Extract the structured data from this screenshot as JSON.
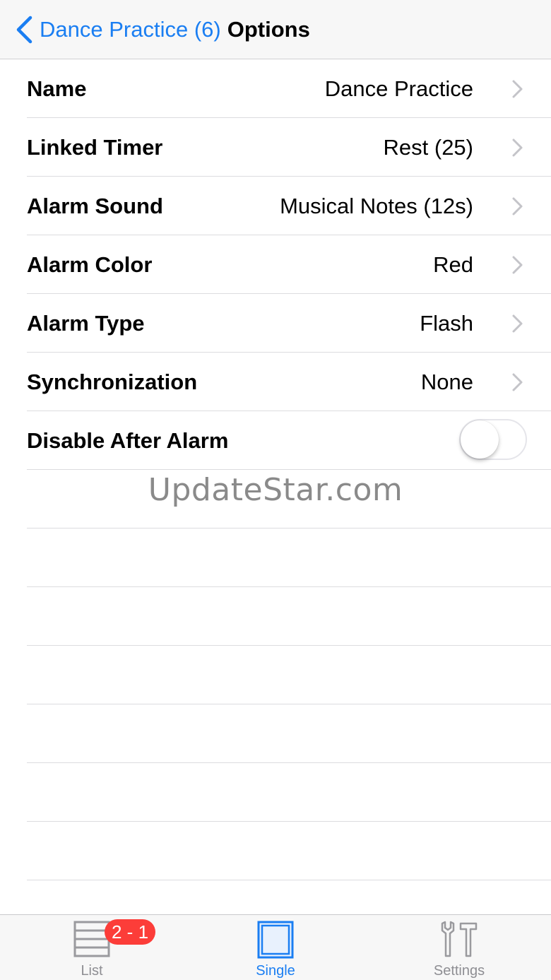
{
  "navbar": {
    "back_label": "Dance Practice (6)",
    "title": "Options"
  },
  "rows": [
    {
      "label": "Name",
      "value": "Dance Practice"
    },
    {
      "label": "Linked Timer",
      "value": "Rest (25)"
    },
    {
      "label": "Alarm Sound",
      "value": "Musical Notes (12s)"
    },
    {
      "label": "Alarm Color",
      "value": "Red"
    },
    {
      "label": "Alarm Type",
      "value": "Flash"
    },
    {
      "label": "Synchronization",
      "value": "None"
    }
  ],
  "toggle_row": {
    "label": "Disable After Alarm",
    "on": false
  },
  "watermark": "UpdateStar.com",
  "tabbar": {
    "list": {
      "label": "List",
      "badge": "2 - 1"
    },
    "single": {
      "label": "Single",
      "selected": true
    },
    "settings": {
      "label": "Settings"
    }
  },
  "colors": {
    "accent": "#1a7ef2",
    "badge": "#fc3d39",
    "inactive": "#8e8e93"
  },
  "icons": {
    "back": "chevron-left-icon",
    "disclosure": "chevron-right-icon",
    "list": "list-icon",
    "single": "square-icon",
    "settings": "tools-icon"
  }
}
